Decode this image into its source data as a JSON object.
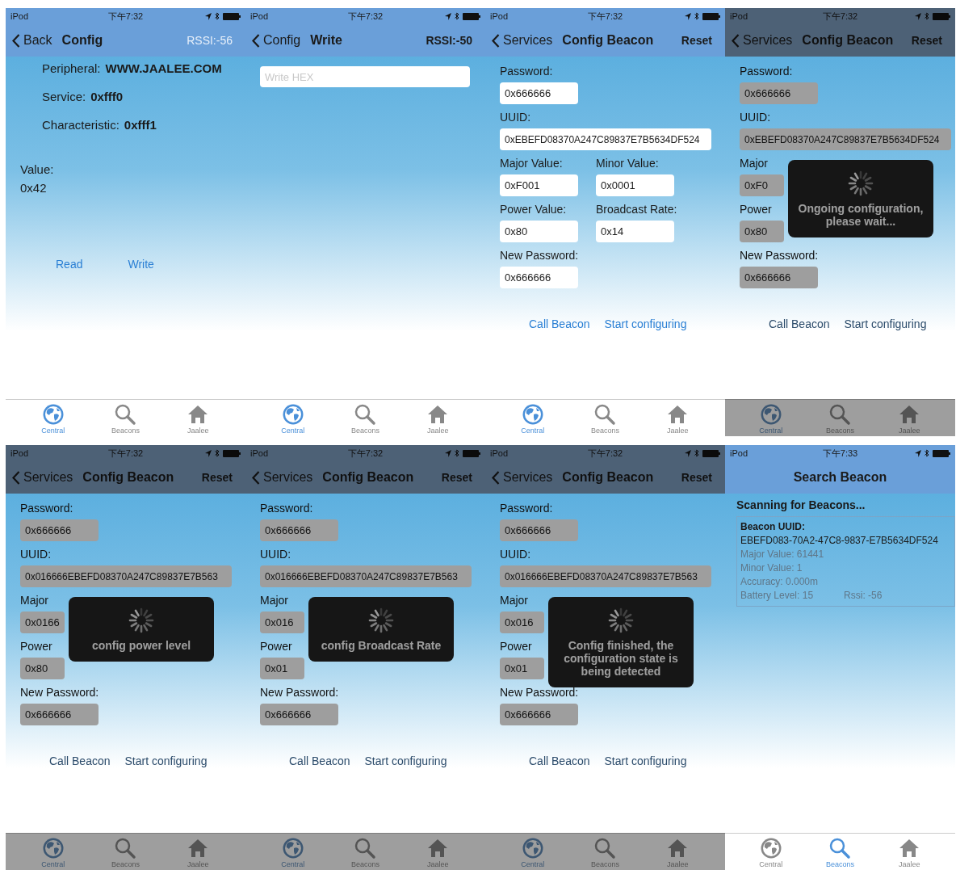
{
  "screens": [
    {
      "kind": "detail",
      "dimmed": false,
      "status": {
        "carrier": "iPod",
        "time": "下午7:32"
      },
      "nav": {
        "back": "Back",
        "title": "Config",
        "right": "RSSI:-56",
        "right_disabled": true
      },
      "rows": [
        {
          "label": "Peripheral:",
          "value": "WWW.JAALEE.COM"
        },
        {
          "label": "Service:",
          "value": "0xfff0"
        },
        {
          "label": "Characteristic:",
          "value": "0xfff1"
        }
      ],
      "value_label": "Value:",
      "value": "0x42",
      "actions": [
        "Read",
        "Write"
      ],
      "tabs": [
        {
          "label": "Central",
          "selected": true
        },
        {
          "label": "Beacons",
          "selected": false
        },
        {
          "label": "Jaalee",
          "selected": false
        }
      ]
    },
    {
      "kind": "write",
      "dimmed": false,
      "status": {
        "carrier": "iPod",
        "time": "下午7:32"
      },
      "nav": {
        "back": "Config",
        "title": "Write",
        "right": "RSSI:-50",
        "right_disabled": false
      },
      "input": {
        "placeholder": "Write HEX"
      },
      "tabs": [
        {
          "label": "Central",
          "selected": true
        },
        {
          "label": "Beacons",
          "selected": false
        },
        {
          "label": "Jaalee",
          "selected": false
        }
      ]
    },
    {
      "kind": "config",
      "dimmed": false,
      "status": {
        "carrier": "iPod",
        "time": "下午7:32"
      },
      "nav": {
        "back": "Services",
        "title": "Config Beacon",
        "right": "Reset",
        "right_disabled": false
      },
      "fields": {
        "password": {
          "label": "Password:",
          "value": "0x666666"
        },
        "uuid": {
          "label": "UUID:",
          "value": "0xEBEFD08370A247C89837E7B5634DF524"
        },
        "major": {
          "label": "Major Value:",
          "value": "0xF001"
        },
        "minor": {
          "label": "Minor Value:",
          "value": "0x0001"
        },
        "power": {
          "label": "Power Value:",
          "value": "0x80"
        },
        "rate": {
          "label": "Broadcast Rate:",
          "value": "0x14"
        },
        "new_password": {
          "label": "New Password:",
          "value": "0x666666"
        }
      },
      "actions": [
        "Call Beacon",
        "Start configuring"
      ],
      "tabs": [
        {
          "label": "Central",
          "selected": true
        },
        {
          "label": "Beacons",
          "selected": false
        },
        {
          "label": "Jaalee",
          "selected": false
        }
      ]
    },
    {
      "kind": "config",
      "dimmed": true,
      "status": {
        "carrier": "iPod",
        "time": "下午7:32"
      },
      "nav": {
        "back": "Services",
        "title": "Config Beacon",
        "right": "Reset",
        "right_disabled": false
      },
      "fields": {
        "password": {
          "label": "Password:",
          "value": "0x666666"
        },
        "uuid": {
          "label": "UUID:",
          "value": "0xEBEFD08370A247C89837E7B5634DF524"
        },
        "major": {
          "label": "Major",
          "value": "0xF0"
        },
        "power": {
          "label": "Power",
          "value": "0x80"
        },
        "new_password": {
          "label": "New Password:",
          "value": "0x666666"
        }
      },
      "actions": [
        "Call Beacon",
        "Start configuring"
      ],
      "hud": "Ongoing configuration, please wait...",
      "tabs": [
        {
          "label": "Central",
          "selected": true
        },
        {
          "label": "Beacons",
          "selected": false
        },
        {
          "label": "Jaalee",
          "selected": false
        }
      ]
    },
    {
      "kind": "config",
      "dimmed": true,
      "status": {
        "carrier": "iPod",
        "time": "下午7:32"
      },
      "nav": {
        "back": "Services",
        "title": "Config Beacon",
        "right": "Reset",
        "right_disabled": false
      },
      "fields": {
        "password": {
          "label": "Password:",
          "value": "0x666666"
        },
        "uuid": {
          "label": "UUID:",
          "value": "0x016666EBEFD08370A247C89837E7B563"
        },
        "major": {
          "label": "Major",
          "value": "0x0166"
        },
        "power": {
          "label": "Power",
          "value": "0x80"
        },
        "new_password": {
          "label": "New Password:",
          "value": "0x666666"
        }
      },
      "actions": [
        "Call Beacon",
        "Start configuring"
      ],
      "hud": "config power level",
      "tabs": [
        {
          "label": "Central",
          "selected": true
        },
        {
          "label": "Beacons",
          "selected": false
        },
        {
          "label": "Jaalee",
          "selected": false
        }
      ]
    },
    {
      "kind": "config",
      "dimmed": true,
      "status": {
        "carrier": "iPod",
        "time": "下午7:32"
      },
      "nav": {
        "back": "Services",
        "title": "Config Beacon",
        "right": "Reset",
        "right_disabled": false
      },
      "fields": {
        "password": {
          "label": "Password:",
          "value": "0x666666"
        },
        "uuid": {
          "label": "UUID:",
          "value": "0x016666EBEFD08370A247C89837E7B563"
        },
        "major": {
          "label": "Major",
          "value": "0x016"
        },
        "power": {
          "label": "Power",
          "value": "0x01"
        },
        "new_password": {
          "label": "New Password:",
          "value": "0x666666"
        }
      },
      "actions": [
        "Call Beacon",
        "Start configuring"
      ],
      "hud": "config Broadcast Rate",
      "tabs": [
        {
          "label": "Central",
          "selected": true
        },
        {
          "label": "Beacons",
          "selected": false
        },
        {
          "label": "Jaalee",
          "selected": false
        }
      ]
    },
    {
      "kind": "config",
      "dimmed": true,
      "status": {
        "carrier": "iPod",
        "time": "下午7:32"
      },
      "nav": {
        "back": "Services",
        "title": "Config Beacon",
        "right": "Reset",
        "right_disabled": false
      },
      "fields": {
        "password": {
          "label": "Password:",
          "value": "0x666666"
        },
        "uuid": {
          "label": "UUID:",
          "value": "0x016666EBEFD08370A247C89837E7B563"
        },
        "major": {
          "label": "Major",
          "value": "0x016"
        },
        "power": {
          "label": "Power",
          "value": "0x01"
        },
        "new_password": {
          "label": "New Password:",
          "value": "0x666666"
        }
      },
      "actions": [
        "Call Beacon",
        "Start configuring"
      ],
      "hud": "Config finished, the configuration state is being detected",
      "tabs": [
        {
          "label": "Central",
          "selected": true
        },
        {
          "label": "Beacons",
          "selected": false
        },
        {
          "label": "Jaalee",
          "selected": false
        }
      ]
    },
    {
      "kind": "search",
      "dimmed": false,
      "status": {
        "carrier": "iPod",
        "time": "下午7:33"
      },
      "nav": {
        "title": "Search Beacon"
      },
      "heading": "Scanning for Beacons...",
      "beacon": {
        "uuid_label": "Beacon UUID:",
        "uuid": "EBEFD083-70A2-47C8-9837-E7B5634DF524",
        "lines": [
          "Major Value:  61441",
          "Minor Value:  1",
          "Accuracy:  0.000m"
        ],
        "battery": "Battery Level: 15",
        "rssi": "Rssi:  -56"
      },
      "tabs": [
        {
          "label": "Central",
          "selected": false
        },
        {
          "label": "Beacons",
          "selected": true
        },
        {
          "label": "Jaalee",
          "selected": false
        }
      ]
    }
  ]
}
